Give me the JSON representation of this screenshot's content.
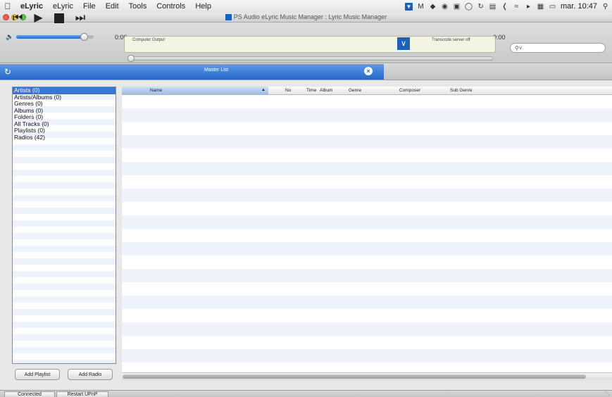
{
  "menubar": {
    "apple_icon": "apple-icon",
    "items": [
      "eLyric",
      "eLyric",
      "File",
      "Edit",
      "Tools",
      "Controls",
      "Help"
    ],
    "clock": "mar. 10:47",
    "status_icons": [
      "psaudio-icon",
      "m-icon",
      "dropbox-icon",
      "evernote-icon",
      "battery-icon",
      "time-machine-icon",
      "sync-icon",
      "display-icon",
      "bluetooth-icon",
      "wifi-icon",
      "volume-icon",
      "keyboard-icon",
      "battery-level-icon",
      "spotlight-icon"
    ]
  },
  "window": {
    "title": "PS Audio eLyric Music Manager : Lyric Music Manager"
  },
  "toolbar": {
    "time_left": "0:00",
    "time_right": "0:00",
    "output_label": "Computer Output",
    "transcode_label": "Transcode server off",
    "volume_fraction": 0.88,
    "progress_fraction": 0.0,
    "search_placeholder": ""
  },
  "tab": {
    "label": "Master List"
  },
  "sidebar": {
    "items": [
      {
        "label": "Artists (0)",
        "selected": true
      },
      {
        "label": "Artists/Albums (0)",
        "selected": false
      },
      {
        "label": "Genres (0)",
        "selected": false
      },
      {
        "label": "Albums (0)",
        "selected": false
      },
      {
        "label": "Folders (0)",
        "selected": false
      },
      {
        "label": "All Tracks (0)",
        "selected": false
      },
      {
        "label": "Playlists (0)",
        "selected": false
      },
      {
        "label": "Radios (42)",
        "selected": false
      }
    ],
    "add_playlist": "Add Playlist",
    "add_radio": "Add Radio"
  },
  "table": {
    "columns": [
      "Name",
      "No",
      "Time",
      "Album",
      "Genre",
      "Composer",
      "Sub Genre"
    ],
    "sorted_column": "Name",
    "rows": []
  },
  "statusbar": {
    "connected": "Connected",
    "restart": "Restart UPnP"
  },
  "colors": {
    "accent": "#2567c8",
    "selection": "#3875d7",
    "stripe": "#eef3fb"
  }
}
